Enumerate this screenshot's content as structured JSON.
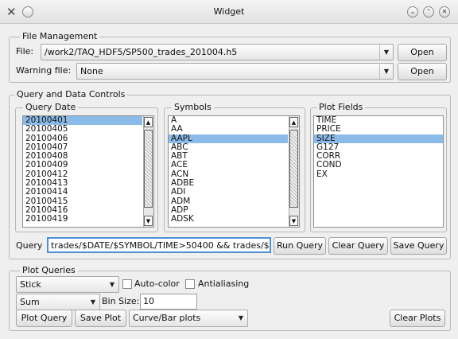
{
  "window": {
    "title": "Widget"
  },
  "file_management": {
    "group_label": "File Management",
    "file_label": "File:",
    "file_value": "/work2/TAQ_HDF5/SP500_trades_201004.h5",
    "open_label": "Open",
    "warning_label": "Warning file:",
    "warning_value": "None",
    "warning_open_label": "Open"
  },
  "query_controls": {
    "group_label": "Query and Data Controls",
    "query_date": {
      "label": "Query Date",
      "items": [
        "20100401",
        "20100405",
        "20100406",
        "20100407",
        "20100408",
        "20100409",
        "20100412",
        "20100413",
        "20100414",
        "20100415",
        "20100416",
        "20100419"
      ],
      "selected": 0
    },
    "symbols": {
      "label": "Symbols",
      "items": [
        "A",
        "AA",
        "AAPL",
        "ABC",
        "ABT",
        "ACE",
        "ACN",
        "ADBE",
        "ADI",
        "ADM",
        "ADP",
        "ADSK"
      ],
      "selected": 2
    },
    "plot_fields": {
      "label": "Plot Fields",
      "items": [
        "TIME",
        "PRICE",
        "SIZE",
        "G127",
        "CORR",
        "COND",
        "EX"
      ],
      "selected": 2
    },
    "query_label": "Query",
    "query_value": "trades/$DATE/$SYMBOL/TIME>50400 && trades/$",
    "run_query": "Run Query",
    "clear_query": "Clear Query",
    "save_query": "Save Query"
  },
  "plot_queries": {
    "group_label": "Plot Queries",
    "style_value": "Stick",
    "auto_color": "Auto-color",
    "antialiasing": "Antialiasing",
    "agg_value": "Sum",
    "bin_size_label": "Bin Size:",
    "bin_size_value": "10",
    "plot_query": "Plot Query",
    "save_plot": "Save Plot",
    "plot_type_value": "Curve/Bar plots",
    "clear_plots": "Clear Plots"
  }
}
